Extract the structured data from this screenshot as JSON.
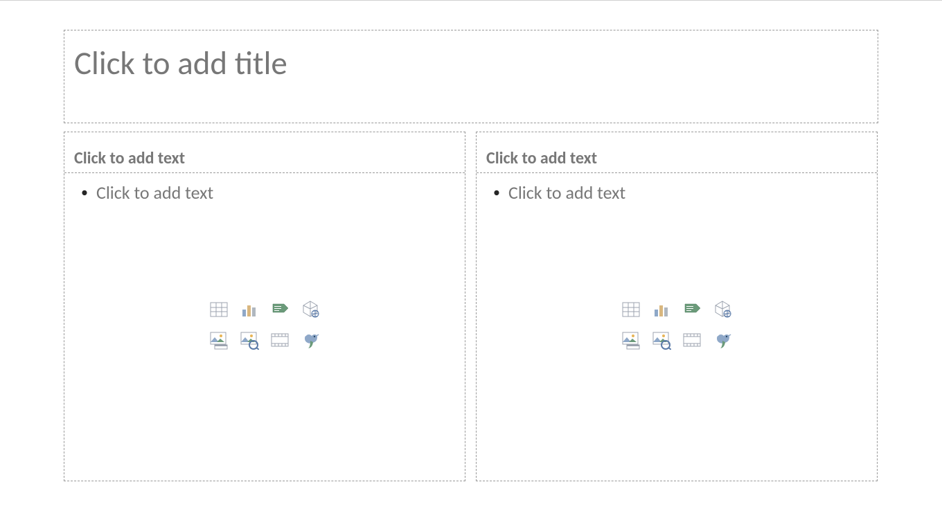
{
  "title": {
    "placeholder": "Click to add title"
  },
  "content": {
    "left": {
      "header": "Click to add text",
      "body": "Click to add text"
    },
    "right": {
      "header": "Click to add text",
      "body": "Click to add text"
    }
  },
  "iconNames": {
    "table": "Insert Table",
    "chart": "Insert Chart",
    "smartart": "Insert SmartArt",
    "model3d": "Insert 3D Model",
    "picture": "Insert Picture",
    "onlinePicture": "Insert Online Picture",
    "video": "Insert Video",
    "iconGraphic": "Insert Icon"
  }
}
